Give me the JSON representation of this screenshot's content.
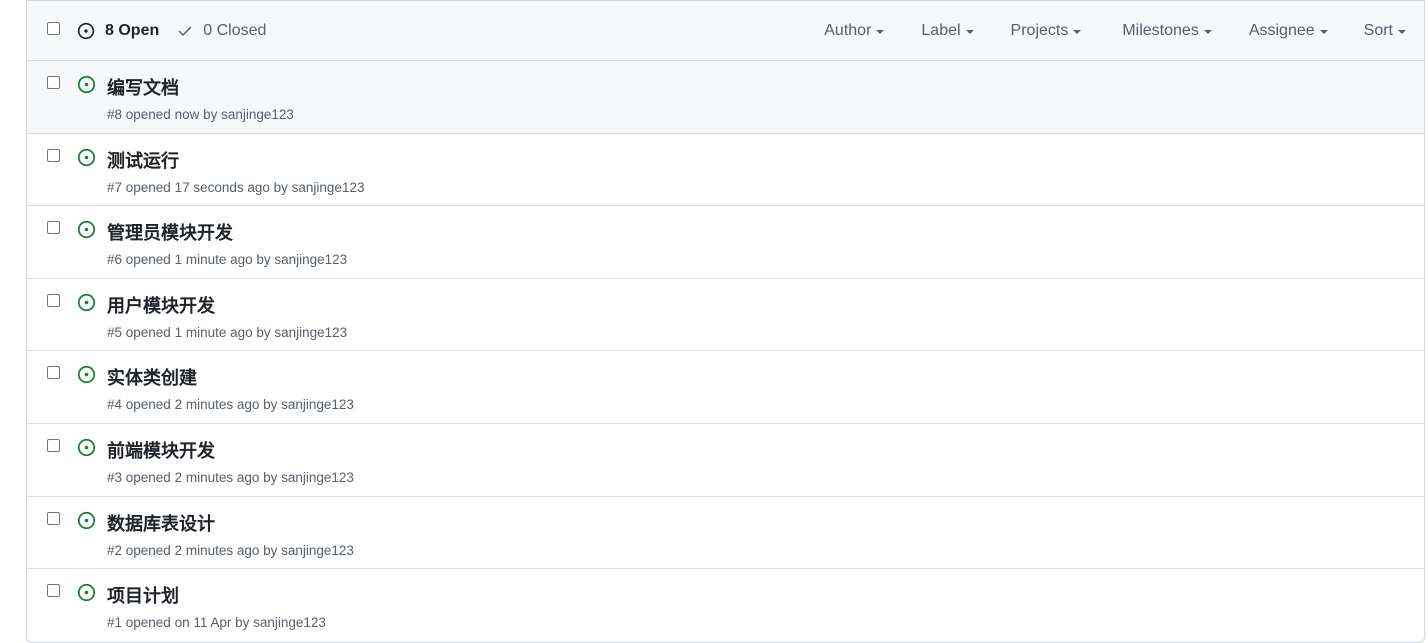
{
  "header": {
    "open_label": "8 Open",
    "closed_label": "0 Closed",
    "filters": {
      "author": "Author",
      "label": "Label",
      "projects": "Projects",
      "milestones": "Milestones",
      "assignee": "Assignee",
      "sort": "Sort"
    }
  },
  "colors": {
    "open_icon": "#1a7f37",
    "muted_text": "#57606a"
  },
  "issues": [
    {
      "title": "编写文档",
      "meta": "#8 opened now by sanjinge123",
      "icon": "issue-opened-icon"
    },
    {
      "title": "测试运行",
      "meta": "#7 opened 17 seconds ago by sanjinge123",
      "icon": "issue-opened-icon"
    },
    {
      "title": "管理员模块开发",
      "meta": "#6 opened 1 minute ago by sanjinge123",
      "icon": "issue-opened-icon"
    },
    {
      "title": "用户模块开发",
      "meta": "#5 opened 1 minute ago by sanjinge123",
      "icon": "issue-opened-icon"
    },
    {
      "title": "实体类创建",
      "meta": "#4 opened 2 minutes ago by sanjinge123",
      "icon": "issue-opened-icon"
    },
    {
      "title": "前端模块开发",
      "meta": "#3 opened 2 minutes ago by sanjinge123",
      "icon": "issue-opened-icon"
    },
    {
      "title": "数据库表设计",
      "meta": "#2 opened 2 minutes ago by sanjinge123",
      "icon": "issue-opened-icon"
    },
    {
      "title": "项目计划",
      "meta": "#1 opened on 11 Apr by sanjinge123",
      "icon": "issue-opened-icon"
    }
  ]
}
